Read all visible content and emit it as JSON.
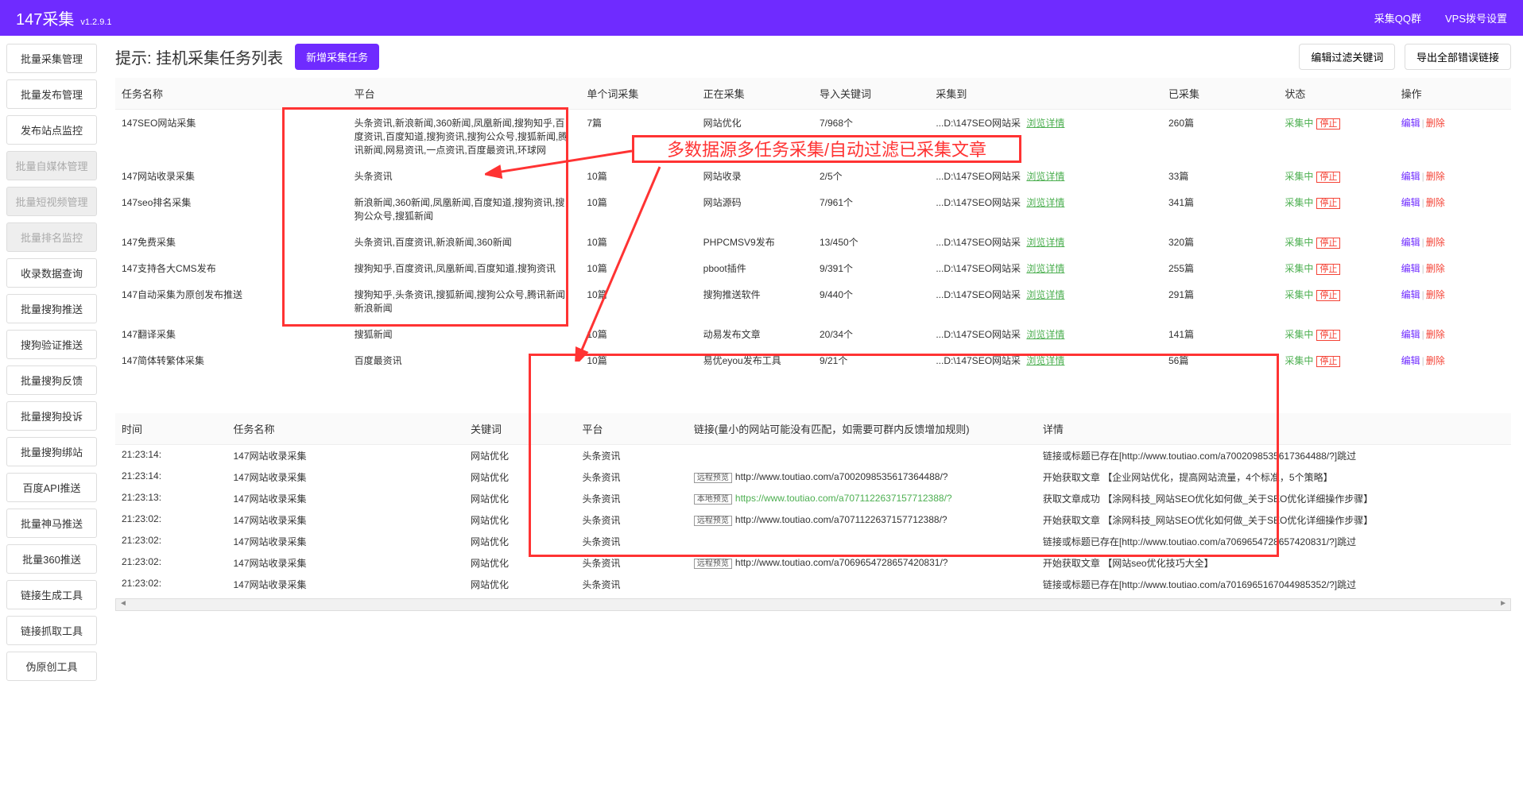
{
  "header": {
    "title": "147采集",
    "version": "v1.2.9.1",
    "links": {
      "qq": "采集QQ群",
      "vps": "VPS拨号设置"
    }
  },
  "sidebar": {
    "items": [
      {
        "label": "批量采集管理",
        "disabled": false
      },
      {
        "label": "批量发布管理",
        "disabled": false
      },
      {
        "label": "发布站点监控",
        "disabled": false
      },
      {
        "label": "批量自媒体管理",
        "disabled": true
      },
      {
        "label": "批量短视频管理",
        "disabled": true
      },
      {
        "label": "批量排名监控",
        "disabled": true
      },
      {
        "label": "收录数据查询",
        "disabled": false
      },
      {
        "label": "批量搜狗推送",
        "disabled": false
      },
      {
        "label": "搜狗验证推送",
        "disabled": false
      },
      {
        "label": "批量搜狗反馈",
        "disabled": false
      },
      {
        "label": "批量搜狗投诉",
        "disabled": false
      },
      {
        "label": "批量搜狗绑站",
        "disabled": false
      },
      {
        "label": "百度API推送",
        "disabled": false
      },
      {
        "label": "批量神马推送",
        "disabled": false
      },
      {
        "label": "批量360推送",
        "disabled": false
      },
      {
        "label": "链接生成工具",
        "disabled": false
      },
      {
        "label": "链接抓取工具",
        "disabled": false
      },
      {
        "label": "伪原创工具",
        "disabled": false
      }
    ]
  },
  "page": {
    "title_prefix": "提示:",
    "title": "挂机采集任务列表",
    "add_btn": "新增采集任务",
    "filter_btn": "编辑过滤关键词",
    "export_btn": "导出全部错误链接"
  },
  "tasks": {
    "headers": {
      "name": "任务名称",
      "platform": "平台",
      "single": "单个词采集",
      "collecting": "正在采集",
      "import": "导入关键词",
      "dest": "采集到",
      "collected": "已采集",
      "status": "状态",
      "op": "操作"
    },
    "status_text": "采集中",
    "stop_text": "停止",
    "browse_text": "浏览详情",
    "edit_text": "编辑",
    "delete_text": "删除",
    "rows": [
      {
        "name": "147SEO网站采集",
        "platform": "头条资讯,新浪新闻,360新闻,凤凰新闻,搜狗知乎,百度资讯,百度知道,搜狗资讯,搜狗公众号,搜狐新闻,腾讯新闻,网易资讯,一点资讯,百度最资讯,环球网",
        "single": "7篇",
        "collecting": "网站优化",
        "import": "7/968个",
        "dest": "...D:\\147SEO网站采",
        "collected": "260篇"
      },
      {
        "name": "147网站收录采集",
        "platform": "头条资讯",
        "single": "10篇",
        "collecting": "网站收录",
        "import": "2/5个",
        "dest": "...D:\\147SEO网站采",
        "collected": "33篇"
      },
      {
        "name": "147seo排名采集",
        "platform": "新浪新闻,360新闻,凤凰新闻,百度知道,搜狗资讯,搜狗公众号,搜狐新闻",
        "single": "10篇",
        "collecting": "网站源码",
        "import": "7/961个",
        "dest": "...D:\\147SEO网站采",
        "collected": "341篇"
      },
      {
        "name": "147免费采集",
        "platform": "头条资讯,百度资讯,新浪新闻,360新闻",
        "single": "10篇",
        "collecting": "PHPCMSV9发布",
        "import": "13/450个",
        "dest": "...D:\\147SEO网站采",
        "collected": "320篇"
      },
      {
        "name": "147支持各大CMS发布",
        "platform": "搜狗知乎,百度资讯,凤凰新闻,百度知道,搜狗资讯",
        "single": "10篇",
        "collecting": "pboot插件",
        "import": "9/391个",
        "dest": "...D:\\147SEO网站采",
        "collected": "255篇"
      },
      {
        "name": "147自动采集为原创发布推送",
        "platform": "搜狗知乎,头条资讯,搜狐新闻,搜狗公众号,腾讯新闻,新浪新闻",
        "single": "10篇",
        "collecting": "搜狗推送软件",
        "import": "9/440个",
        "dest": "...D:\\147SEO网站采",
        "collected": "291篇"
      },
      {
        "name": "147翻译采集",
        "platform": "搜狐新闻",
        "single": "10篇",
        "collecting": "动易发布文章",
        "import": "20/34个",
        "dest": "...D:\\147SEO网站采",
        "collected": "141篇"
      },
      {
        "name": "147简体转繁体采集",
        "platform": "百度最资讯",
        "single": "10篇",
        "collecting": "易优eyou发布工具",
        "import": "9/21个",
        "dest": "...D:\\147SEO网站采",
        "collected": "56篇"
      }
    ]
  },
  "logs": {
    "headers": {
      "time": "时间",
      "task": "任务名称",
      "keyword": "关键词",
      "platform": "平台",
      "link": "链接(量小的网站可能没有匹配，如需要可群内反馈增加规则)",
      "detail": "详情"
    },
    "remote_text": "远程预览",
    "local_text": "本地预览",
    "rows": [
      {
        "time": "21:23:14:",
        "task": "147网站收录采集",
        "keyword": "网站优化",
        "platform": "头条资讯",
        "btn": "",
        "url": "",
        "detail": "链接或标题已存在[http://www.toutiao.com/a7002098535617364488/?]跳过"
      },
      {
        "time": "21:23:14:",
        "task": "147网站收录采集",
        "keyword": "网站优化",
        "platform": "头条资讯",
        "btn": "remote",
        "url": "http://www.toutiao.com/a7002098535617364488/?",
        "detail": "开始获取文章 【企业网站优化，提高网站流量，4个标准，5个策略】"
      },
      {
        "time": "21:23:13:",
        "task": "147网站收录采集",
        "keyword": "网站优化",
        "platform": "头条资讯",
        "btn": "local",
        "url": "https://www.toutiao.com/a7071122637157712388/?",
        "green": true,
        "detail": "获取文章成功 【涂网科技_网站SEO优化如何做_关于SEO优化详细操作步骤】"
      },
      {
        "time": "21:23:02:",
        "task": "147网站收录采集",
        "keyword": "网站优化",
        "platform": "头条资讯",
        "btn": "remote",
        "url": "http://www.toutiao.com/a7071122637157712388/?",
        "detail": "开始获取文章 【涂网科技_网站SEO优化如何做_关于SEO优化详细操作步骤】"
      },
      {
        "time": "21:23:02:",
        "task": "147网站收录采集",
        "keyword": "网站优化",
        "platform": "头条资讯",
        "btn": "",
        "url": "",
        "detail": "链接或标题已存在[http://www.toutiao.com/a7069654728657420831/?]跳过"
      },
      {
        "time": "21:23:02:",
        "task": "147网站收录采集",
        "keyword": "网站优化",
        "platform": "头条资讯",
        "btn": "remote",
        "url": "http://www.toutiao.com/a7069654728657420831/?",
        "detail": "开始获取文章 【网站seo优化技巧大全】"
      },
      {
        "time": "21:23:02:",
        "task": "147网站收录采集",
        "keyword": "网站优化",
        "platform": "头条资讯",
        "btn": "",
        "url": "",
        "detail": "链接或标题已存在[http://www.toutiao.com/a7016965167044985352/?]跳过"
      }
    ]
  },
  "annotation": {
    "label": "多数据源多任务采集/自动过滤已采集文章"
  }
}
